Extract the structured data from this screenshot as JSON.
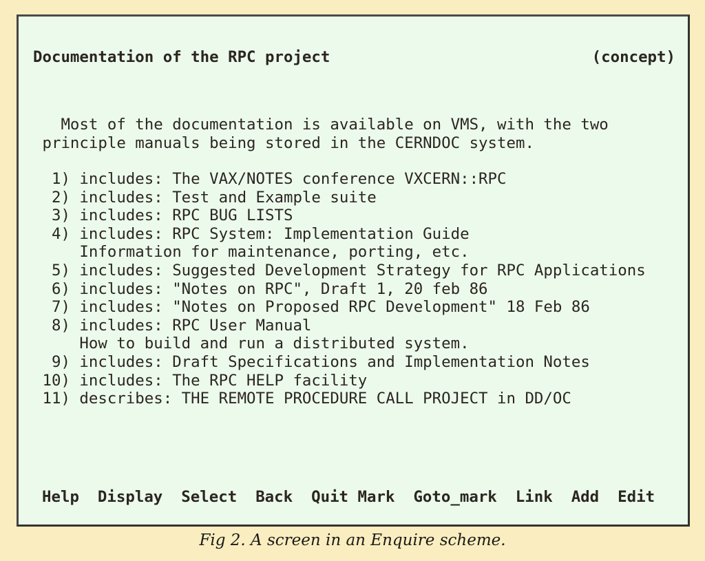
{
  "figure": {
    "caption": "Fig 2. A screen in an Enquire scheme.",
    "screen_background": "#ecfaec",
    "page_background": "#faedbf",
    "text_color": "#2b2620",
    "border_color": "#3b3b3b"
  },
  "screen": {
    "header": {
      "title": "Documentation of the RPC project",
      "node_type": "(concept)"
    },
    "description": [
      "   Most of the documentation is available on VMS, with the two",
      " principle manuals being stored in the CERNDOC system."
    ],
    "links": [
      "  1) includes: The VAX/NOTES conference VXCERN::RPC",
      "  2) includes: Test and Example suite",
      "  3) includes: RPC BUG LISTS",
      "  4) includes: RPC System: Implementation Guide",
      "     Information for maintenance, porting, etc.",
      "  5) includes: Suggested Development Strategy for RPC Applications",
      "  6) includes: \"Notes on RPC\", Draft 1, 20 feb 86",
      "  7) includes: \"Notes on Proposed RPC Development\" 18 Feb 86",
      "  8) includes: RPC User Manual",
      "     How to build and run a distributed system.",
      "  9) includes: Draft Specifications and Implementation Notes",
      " 10) includes: The RPC HELP facility",
      " 11) describes: THE REMOTE PROCEDURE CALL PROJECT in DD/OC"
    ],
    "link_entries": [
      {
        "number": "1",
        "relation": "includes",
        "target": "The VAX/NOTES conference VXCERN::RPC"
      },
      {
        "number": "2",
        "relation": "includes",
        "target": "Test and Example suite"
      },
      {
        "number": "3",
        "relation": "includes",
        "target": "RPC BUG LISTS"
      },
      {
        "number": "4",
        "relation": "includes",
        "target": "RPC System: Implementation Guide",
        "note": "Information for maintenance, porting, etc."
      },
      {
        "number": "5",
        "relation": "includes",
        "target": "Suggested Development Strategy for RPC Applications"
      },
      {
        "number": "6",
        "relation": "includes",
        "target": "\"Notes on RPC\", Draft 1, 20 feb 86"
      },
      {
        "number": "7",
        "relation": "includes",
        "target": "\"Notes on Proposed RPC Development\" 18 Feb 86"
      },
      {
        "number": "8",
        "relation": "includes",
        "target": "RPC User Manual",
        "note": "How to build and run a distributed system."
      },
      {
        "number": "9",
        "relation": "includes",
        "target": "Draft Specifications and Implementation Notes"
      },
      {
        "number": "10",
        "relation": "includes",
        "target": "The RPC HELP facility"
      },
      {
        "number": "11",
        "relation": "describes",
        "target": "THE REMOTE PROCEDURE CALL PROJECT in DD/OC"
      }
    ],
    "menu": [
      {
        "label": "Help",
        "gap_after": "wide"
      },
      {
        "label": "Display",
        "gap_after": "wide"
      },
      {
        "label": "Select",
        "gap_after": "wide"
      },
      {
        "label": "Back",
        "gap_after": "wide"
      },
      {
        "label": "Quit",
        "gap_after": "narrow"
      },
      {
        "label": "Mark",
        "gap_after": "wide"
      },
      {
        "label": "Goto_mark",
        "gap_after": "wide"
      },
      {
        "label": "Link",
        "gap_after": "wide"
      },
      {
        "label": "Add",
        "gap_after": "wide"
      },
      {
        "label": "Edit",
        "gap_after": "none"
      }
    ]
  }
}
